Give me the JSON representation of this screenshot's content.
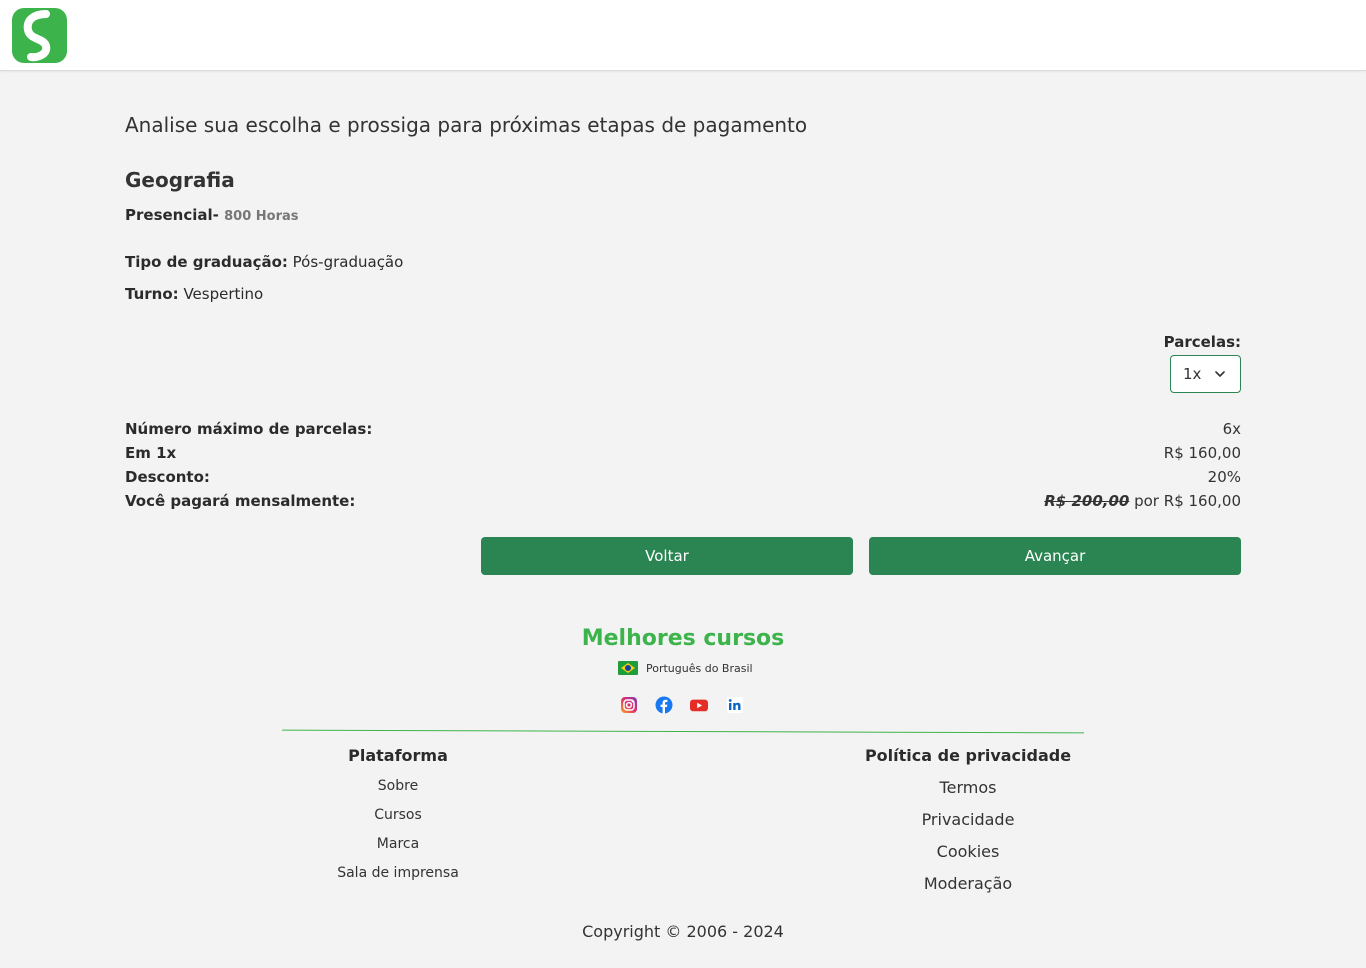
{
  "header": {
    "logo_icon": "green-s-logo"
  },
  "page": {
    "heading": "Analise sua escolha e prossiga para próximas etapas de pagamento"
  },
  "course": {
    "name": "Geografia",
    "modality": "Presencial-",
    "hours": "800 Horas",
    "graduation_label": "Tipo de graduação:",
    "graduation_value": "Pós-graduação",
    "shift_label": "Turno:",
    "shift_value": "Vespertino"
  },
  "installments": {
    "label": "Parcelas:",
    "selected": "1x"
  },
  "summary": {
    "max_label": "Número máximo de parcelas:",
    "max_value": "6x",
    "in1x_label": "Em 1x",
    "in1x_value": "R$ 160,00",
    "discount_label": "Desconto:",
    "discount_value": "20%",
    "monthly_label": "Você pagará mensalmente:",
    "monthly_old": "R$ 200,00",
    "monthly_connector": "por",
    "monthly_new": "R$ 160,00"
  },
  "actions": {
    "back": "Voltar",
    "next": "Avançar"
  },
  "footer": {
    "brand": "Melhores cursos",
    "language": "Português do Brasil",
    "platform_title": "Plataforma",
    "platform_links": [
      "Sobre",
      "Cursos",
      "Marca",
      "Sala de imprensa"
    ],
    "privacy_title": "Política de privacidade",
    "privacy_links": [
      "Termos",
      "Privacidade",
      "Cookies",
      "Moderação"
    ],
    "social": [
      "instagram-icon",
      "facebook-icon",
      "youtube-icon",
      "linkedin-icon"
    ],
    "copyright": "Copyright © 2006 - 2024"
  },
  "colors": {
    "primary": "#2a8553",
    "brand": "#3cb44b",
    "background": "#f3f3f3"
  }
}
